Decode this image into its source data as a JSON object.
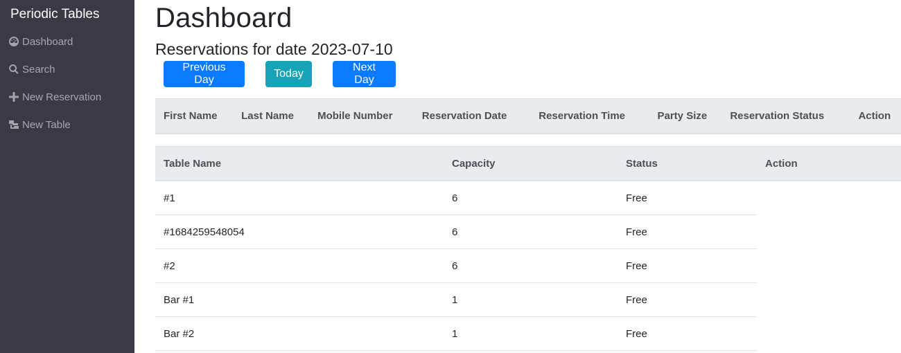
{
  "sidebar": {
    "brand": "Periodic Tables",
    "items": [
      {
        "label": "Dashboard",
        "icon": "dashboard-icon"
      },
      {
        "label": "Search",
        "icon": "search-icon"
      },
      {
        "label": "New Reservation",
        "icon": "plus-icon"
      },
      {
        "label": "New Table",
        "icon": "table-icon"
      }
    ]
  },
  "main": {
    "title": "Dashboard",
    "subtitle": "Reservations for date 2023-07-10",
    "buttons": {
      "previous": "Previous Day",
      "today": "Today",
      "next": "Next Day"
    },
    "reservations": {
      "headers": [
        "First Name",
        "Last Name",
        "Mobile Number",
        "Reservation Date",
        "Reservation Time",
        "Party Size",
        "Reservation Status",
        "Action"
      ]
    },
    "tables": {
      "headers": [
        "Table Name",
        "Capacity",
        "Status",
        "Action"
      ],
      "rows": [
        [
          "#1",
          "6",
          "Free"
        ],
        [
          "#1684259548054",
          "6",
          "Free"
        ],
        [
          "#2",
          "6",
          "Free"
        ],
        [
          "Bar #1",
          "1",
          "Free"
        ],
        [
          "Bar #2",
          "1",
          "Free"
        ]
      ]
    }
  },
  "colors": {
    "sidebar_bg": "#3a3a44",
    "primary": "#0a7bff",
    "info": "#17a2b8",
    "header_bg": "#e9ecef"
  }
}
